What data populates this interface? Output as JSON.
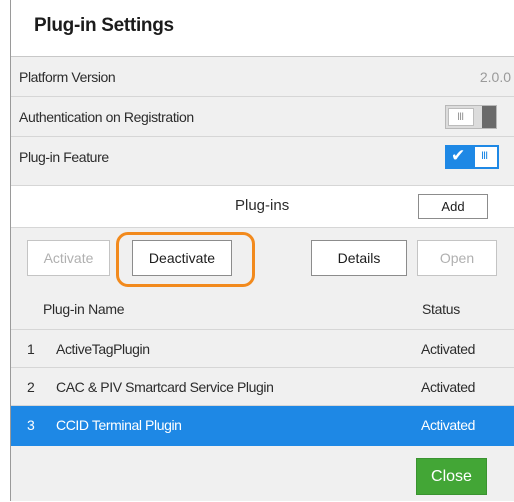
{
  "dialog": {
    "title": "Plug-in Settings"
  },
  "settings": {
    "platform_version_label": "Platform Version",
    "platform_version_value": "2.0.0",
    "auth_label": "Authentication on Registration",
    "auth_enabled": false,
    "plugin_feature_label": "Plug-in Feature",
    "plugin_feature_enabled": true,
    "toggle_check_glyph": "✔",
    "toggle_knob_glyph": "III"
  },
  "plugins": {
    "title": "Plug-ins",
    "add_label": "Add"
  },
  "toolbar": {
    "activate_label": "Activate",
    "deactivate_label": "Deactivate",
    "details_label": "Details",
    "open_label": "Open"
  },
  "table": {
    "col_name": "Plug-in Name",
    "col_status": "Status",
    "rows": [
      {
        "index": "1",
        "name": "ActiveTagPlugin",
        "status": "Activated",
        "selected": false
      },
      {
        "index": "2",
        "name": "CAC & PIV Smartcard Service Plugin",
        "status": "Activated",
        "selected": false
      },
      {
        "index": "3",
        "name": "CCID Terminal Plugin",
        "status": "Activated",
        "selected": true
      }
    ]
  },
  "footer": {
    "close_label": "Close"
  },
  "colors": {
    "accent_blue": "#1e88e5",
    "close_green": "#43a636",
    "highlight_orange": "#f28a1d"
  }
}
